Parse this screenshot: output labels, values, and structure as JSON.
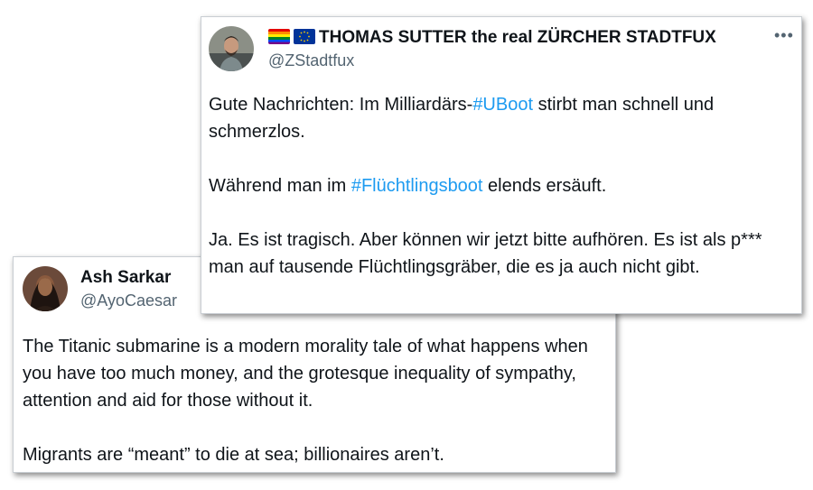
{
  "front_tweet": {
    "display_name": "THOMAS SUTTER the real ZÜRCHER STADTFUX",
    "handle": "@ZStadtfux",
    "emoji_icons": [
      "rainbow-flag-icon",
      "eu-flag-icon"
    ],
    "more_icon": "more-options-icon",
    "paragraphs": {
      "p1_before": "Gute Nachrichten: Im Milliardärs-",
      "p1_hashtag": "#UBoot",
      "p1_after": " stirbt man schnell und schmerzlos.",
      "p2_before": "Während man im ",
      "p2_hashtag": "#Flüchtlingsboot",
      "p2_after": " elends ersäuft.",
      "p3": "Ja. Es ist tragisch. Aber können wir jetzt bitte aufhören. Es ist als p*** man auf tausende Flüchtlingsgräber, die es ja auch nicht gibt."
    }
  },
  "back_tweet": {
    "display_name": "Ash Sarkar",
    "handle": "@AyoCaesar",
    "paragraphs": {
      "p1": "The Titanic submarine is a modern morality tale of what happens when you have too much money, and the grotesque inequality of sympathy, attention and aid for those without it.",
      "p2": "Migrants are “meant” to die at sea; billionaires aren’t."
    }
  },
  "colors": {
    "hashtag": "#1d9bf0",
    "text": "#0f1419",
    "secondary": "#536471"
  }
}
